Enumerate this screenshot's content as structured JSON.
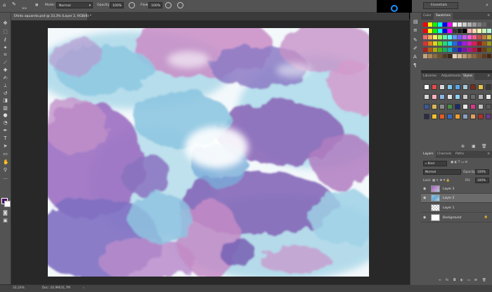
{
  "options_bar": {
    "brush_size": "300",
    "mode_label": "Mode:",
    "mode_value": "Normal",
    "opacity_label": "Opacity:",
    "opacity_value": "100%",
    "flow_label": "Flow:",
    "flow_value": "100%",
    "workspace": "Essentials"
  },
  "document": {
    "tab_title": "Efeito aquarela.psd @ 33,3% (Layer 2, RGB/8) *"
  },
  "status_bar": {
    "zoom": "33,33%",
    "doc_size": "Doc: 24,9M/31,7M"
  },
  "panels": {
    "color_tab": "Color",
    "swatches_tab": "Swatches",
    "libraries_tab": "Libraries",
    "adjustments_tab": "Adjustments",
    "styles_tab": "Styles",
    "layers_tab": "Layers",
    "channels_tab": "Channels",
    "paths_tab": "Paths"
  },
  "layers_panel": {
    "kind_label": "Kind",
    "blend_mode": "Normal",
    "opacity_label": "Opacity:",
    "opacity_value": "100%",
    "lock_label": "Lock:",
    "fill_label": "Fill:",
    "fill_value": "100%",
    "layers": [
      {
        "name": "Layer 3",
        "visible": true,
        "selected": false
      },
      {
        "name": "Layer 2",
        "visible": true,
        "selected": true
      },
      {
        "name": "Layer 1",
        "visible": false,
        "selected": false
      },
      {
        "name": "Background",
        "visible": true,
        "selected": false,
        "locked": true
      }
    ]
  },
  "colors": {
    "foreground": "#4a1166",
    "background": "#ffffff",
    "cortana": "#1e8fff"
  }
}
